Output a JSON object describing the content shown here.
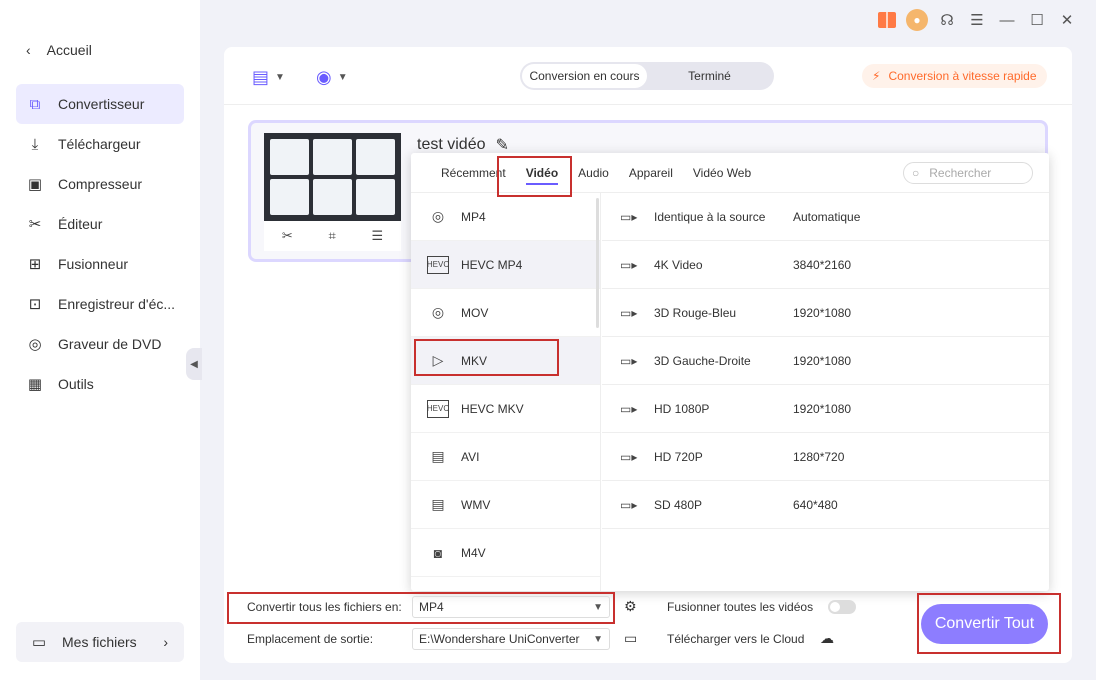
{
  "window": {
    "icons": [
      "gift-icon",
      "avatar-icon",
      "headset-icon",
      "menu-icon",
      "minimize-icon",
      "maximize-icon",
      "close-icon"
    ]
  },
  "sidebar": {
    "back_label": "Accueil",
    "items": [
      {
        "label": "Convertisseur",
        "icon": "convert-icon",
        "active": true
      },
      {
        "label": "Téléchargeur",
        "icon": "download-icon"
      },
      {
        "label": "Compresseur",
        "icon": "compress-icon"
      },
      {
        "label": "Éditeur",
        "icon": "scissors-icon"
      },
      {
        "label": "Fusionneur",
        "icon": "merge-icon"
      },
      {
        "label": "Enregistreur d'éc...",
        "icon": "record-icon"
      },
      {
        "label": "Graveur de DVD",
        "icon": "dvd-icon"
      },
      {
        "label": "Outils",
        "icon": "tools-icon"
      }
    ],
    "myfiles_label": "Mes fichiers"
  },
  "toolbar": {
    "tabs": [
      "Conversion en cours",
      "Terminé"
    ],
    "speed_label": "Conversion à vitesse rapide"
  },
  "file": {
    "title": "test vidéo"
  },
  "dropdown": {
    "tabs": [
      "Récemment",
      "Vidéo",
      "Audio",
      "Appareil",
      "Vidéo Web"
    ],
    "selected_tab": "Vidéo",
    "search_placeholder": "Rechercher",
    "formats": [
      "MP4",
      "HEVC MP4",
      "MOV",
      "MKV",
      "HEVC MKV",
      "AVI",
      "WMV",
      "M4V"
    ],
    "highlighted_format": "MKV",
    "resolutions": [
      {
        "name": "Identique à la source",
        "value": "Automatique"
      },
      {
        "name": "4K Video",
        "value": "3840*2160"
      },
      {
        "name": "3D Rouge-Bleu",
        "value": "1920*1080"
      },
      {
        "name": "3D Gauche-Droite",
        "value": "1920*1080"
      },
      {
        "name": "HD 1080P",
        "value": "1920*1080"
      },
      {
        "name": "HD 720P",
        "value": "1280*720"
      },
      {
        "name": "SD 480P",
        "value": "640*480"
      }
    ]
  },
  "bottom": {
    "convert_all_label": "Convertir tous les fichiers en:",
    "convert_all_value": "MP4",
    "output_label": "Emplacement de sortie:",
    "output_value": "E:\\Wondershare UniConverter",
    "merge_label": "Fusionner toutes les vidéos",
    "cloud_label": "Télécharger vers le Cloud",
    "convert_button": "Convertir Tout"
  },
  "colors": {
    "accent": "#6a5cff",
    "button": "#8d7dff",
    "annotation_red": "#c8302e",
    "speed_orange": "#ff6a2b"
  }
}
